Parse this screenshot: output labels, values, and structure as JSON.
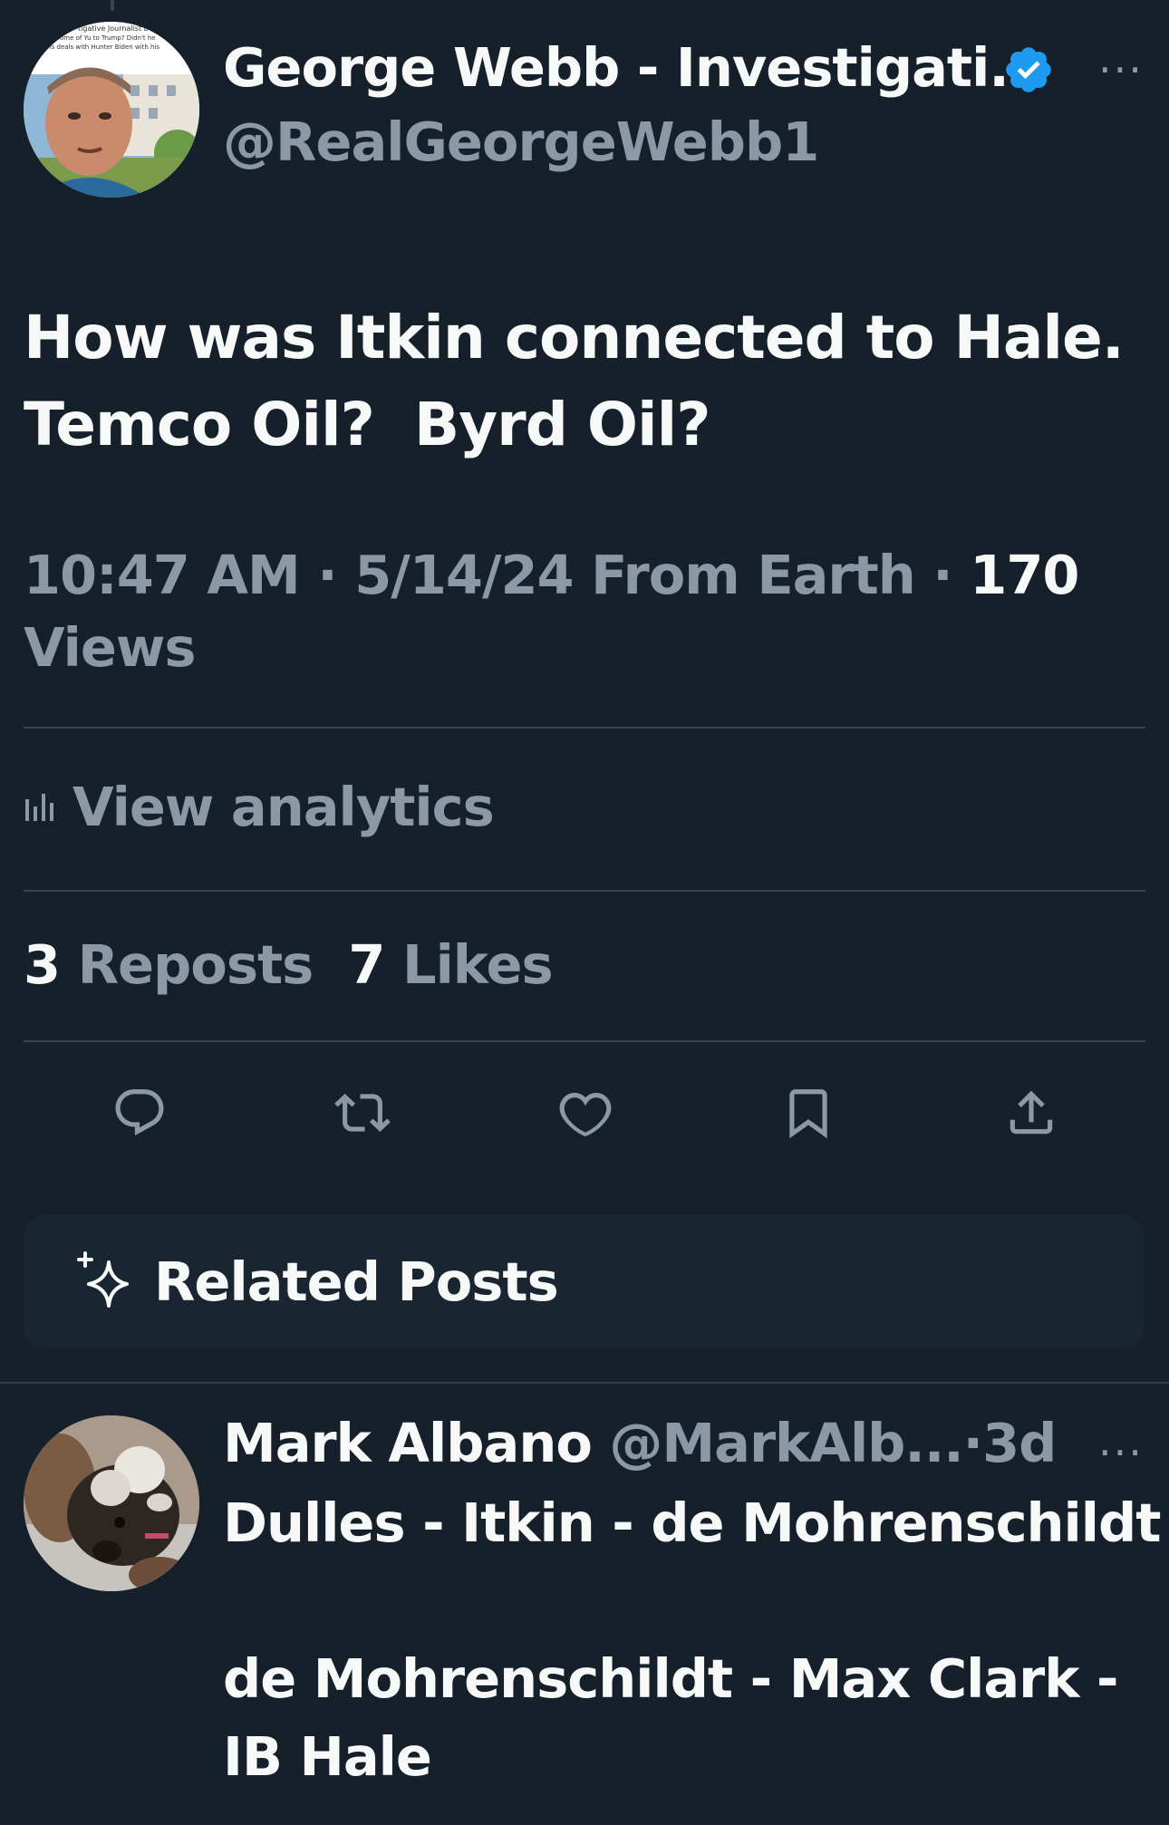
{
  "tweet": {
    "author_name": "George Webb - Investigati...",
    "author_handle": "@RealGeorgeWebb1",
    "avatar_caption_lines": [
      "tigative Journalist b",
      "ome of Yu to Trump? Didn't he",
      "ions deals with Hunter Biden with his"
    ],
    "text_lines": [
      "How was Itkin connected to Hale.",
      "Temco Oil?  Byrd Oil?"
    ],
    "time": "10:47 AM",
    "date": "5/14/24",
    "source": "From Earth",
    "views_count": "170",
    "views_label": "Views",
    "separator": "·",
    "more_label": "···"
  },
  "analytics": {
    "label": "View analytics",
    "icon": "analytics-bars-icon"
  },
  "stats": {
    "reposts_count": "3",
    "reposts_label": "Reposts",
    "likes_count": "7",
    "likes_label": "Likes"
  },
  "actions": [
    "reply-icon",
    "repost-icon",
    "like-icon",
    "bookmark-icon",
    "share-icon"
  ],
  "related": {
    "label": "Related Posts",
    "icon": "sparkle-icon"
  },
  "reply": {
    "author_name": "Mark Albano",
    "author_handle": "@MarkAlb...",
    "time_ago": "3d",
    "separator": "·",
    "more_label": "···",
    "text_lines": [
      "Dulles - Itkin - de Mohrenschildt",
      "",
      "de Mohrenschildt - Max Clark -",
      "IB Hale"
    ]
  },
  "colors": {
    "background": "#15202b",
    "text": "#f7f9f9",
    "muted": "#8b98a5",
    "verified": "#1d9bf0",
    "divider": "#38444d"
  }
}
